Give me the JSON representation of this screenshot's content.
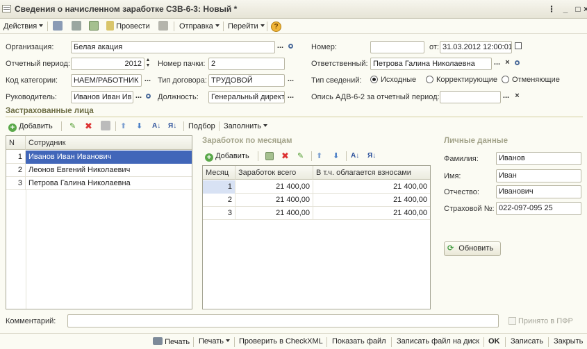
{
  "window": {
    "title": "Сведения о начисленном заработке СЗВ-6-3: Новый *"
  },
  "toolbar": {
    "actions": "Действия",
    "post": "Провести",
    "send": "Отправка",
    "goto": "Перейти",
    "help": "?"
  },
  "form": {
    "org_label": "Организация:",
    "org_value": "Белая акация",
    "period_label": "Отчетный период:",
    "period_value": "2012",
    "pack_label": "Номер пачки:",
    "pack_value": "2",
    "cat_label": "Код категории:",
    "cat_value": "НАЕМ/РАБОТНИК",
    "contract_label": "Тип договора:",
    "contract_value": "ТРУДОВОЙ",
    "head_label": "Руководитель:",
    "head_value": "Иванов Иван Ив",
    "position_label": "Должность:",
    "position_value": "Генеральный директ",
    "number_label": "Номер:",
    "number_value": "",
    "date_label": "от:",
    "date_value": "31.03.2012 12:00:01",
    "resp_label": "Ответственный:",
    "resp_value": "Петрова Галина Николаевна",
    "type_label": "Тип сведений:",
    "type_options": [
      "Исходные",
      "Корректирующие",
      "Отменяющие"
    ],
    "type_selected": "Исходные",
    "adv_label": "Опись АДВ-6-2 за отчетный период:",
    "adv_value": ""
  },
  "insured": {
    "section": "Застрахованные лица",
    "add": "Добавить",
    "pick": "Подбор",
    "fill": "Заполнить",
    "columns": [
      "N",
      "Сотрудник"
    ],
    "rows": [
      {
        "n": "1",
        "name": "Иванов Иван Иванович"
      },
      {
        "n": "2",
        "name": "Леонов Евгений Николаевич"
      },
      {
        "n": "3",
        "name": "Петрова Галина Николаевна"
      }
    ]
  },
  "earnings": {
    "section": "Заработок по месяцам",
    "add": "Добавить",
    "columns": [
      "Месяц",
      "Заработок всего",
      "В т.ч. облагается взносами"
    ],
    "rows": [
      {
        "month": "1",
        "total": "21 400,00",
        "taxed": "21 400,00"
      },
      {
        "month": "2",
        "total": "21 400,00",
        "taxed": "21 400,00"
      },
      {
        "month": "3",
        "total": "21 400,00",
        "taxed": "21 400,00"
      }
    ]
  },
  "personal": {
    "section": "Личные данные",
    "surname_label": "Фамилия:",
    "surname_value": "Иванов",
    "name_label": "Имя:",
    "name_value": "Иван",
    "patronymic_label": "Отчество:",
    "patronymic_value": "Иванович",
    "snils_label": "Страховой №:",
    "snils_value": "022-097-095 25",
    "refresh": "Обновить"
  },
  "comment": {
    "label": "Комментарий:",
    "value": "",
    "accepted": "Принято в ПФР"
  },
  "bottom": {
    "print1": "Печать",
    "print2": "Печать",
    "check": "Проверить в CheckXML",
    "show": "Показать файл",
    "write_disk": "Записать файл на диск",
    "ok": "OK",
    "save": "Записать",
    "close": "Закрыть"
  },
  "colors": {
    "selection": "#4166b9",
    "section": "#6d6d44",
    "background": "#fbfbf3"
  }
}
